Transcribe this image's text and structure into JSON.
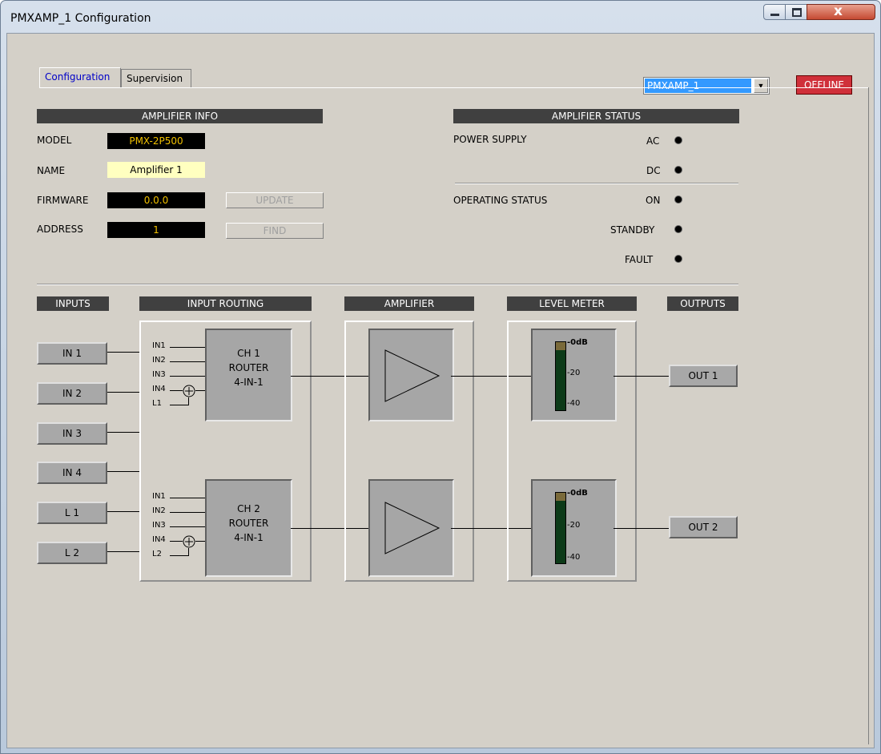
{
  "window": {
    "title": "PMXAMP_1 Configuration",
    "close_glyph": "x"
  },
  "device_select": {
    "value": "PMXAMP_1",
    "arrow": "▼"
  },
  "connection_status": "OFFLINE",
  "tabs": [
    {
      "label": "Configuration",
      "active": true
    },
    {
      "label": "Supervision",
      "active": false
    }
  ],
  "amp_info": {
    "header": "AMPLIFIER INFO",
    "model_label": "MODEL",
    "model_value": "PMX-2P500",
    "name_label": "NAME",
    "name_value": "Amplifier 1",
    "firmware_label": "FIRMWARE",
    "firmware_value": "0.0.0",
    "address_label": "ADDRESS",
    "address_value": "1",
    "update_button": "UPDATE",
    "find_button": "FIND"
  },
  "amp_status": {
    "header": "AMPLIFIER STATUS",
    "power_supply_label": "POWER SUPPLY",
    "ac_label": "AC",
    "dc_label": "DC",
    "operating_status_label": "OPERATING STATUS",
    "on_label": "ON",
    "standby_label": "STANDBY",
    "fault_label": "FAULT"
  },
  "sections": {
    "inputs": "INPUTS",
    "input_routing": "INPUT ROUTING",
    "amplifier": "AMPLIFIER",
    "level_meter": "LEVEL METER",
    "outputs": "OUTPUTS"
  },
  "inputs": [
    "IN 1",
    "IN 2",
    "IN 3",
    "IN 4",
    "L 1",
    "L 2"
  ],
  "routers": [
    {
      "line1": "CH 1",
      "line2": "ROUTER",
      "line3": "4-IN-1",
      "pins": [
        "IN1",
        "IN2",
        "IN3",
        "IN4",
        "L1"
      ]
    },
    {
      "line1": "CH 2",
      "line2": "ROUTER",
      "line3": "4-IN-1",
      "pins": [
        "IN1",
        "IN2",
        "IN3",
        "IN4",
        "L2"
      ]
    }
  ],
  "meter_scale": [
    "-0dB",
    "-20",
    "-40"
  ],
  "outputs": [
    "OUT 1",
    "OUT 2"
  ],
  "colors": {
    "led_off": "#000000",
    "offline_bg": "#d0303a",
    "value_dark_bg": "#000000",
    "value_dark_fg": "#f0c000",
    "name_bg": "#ffffc0"
  }
}
